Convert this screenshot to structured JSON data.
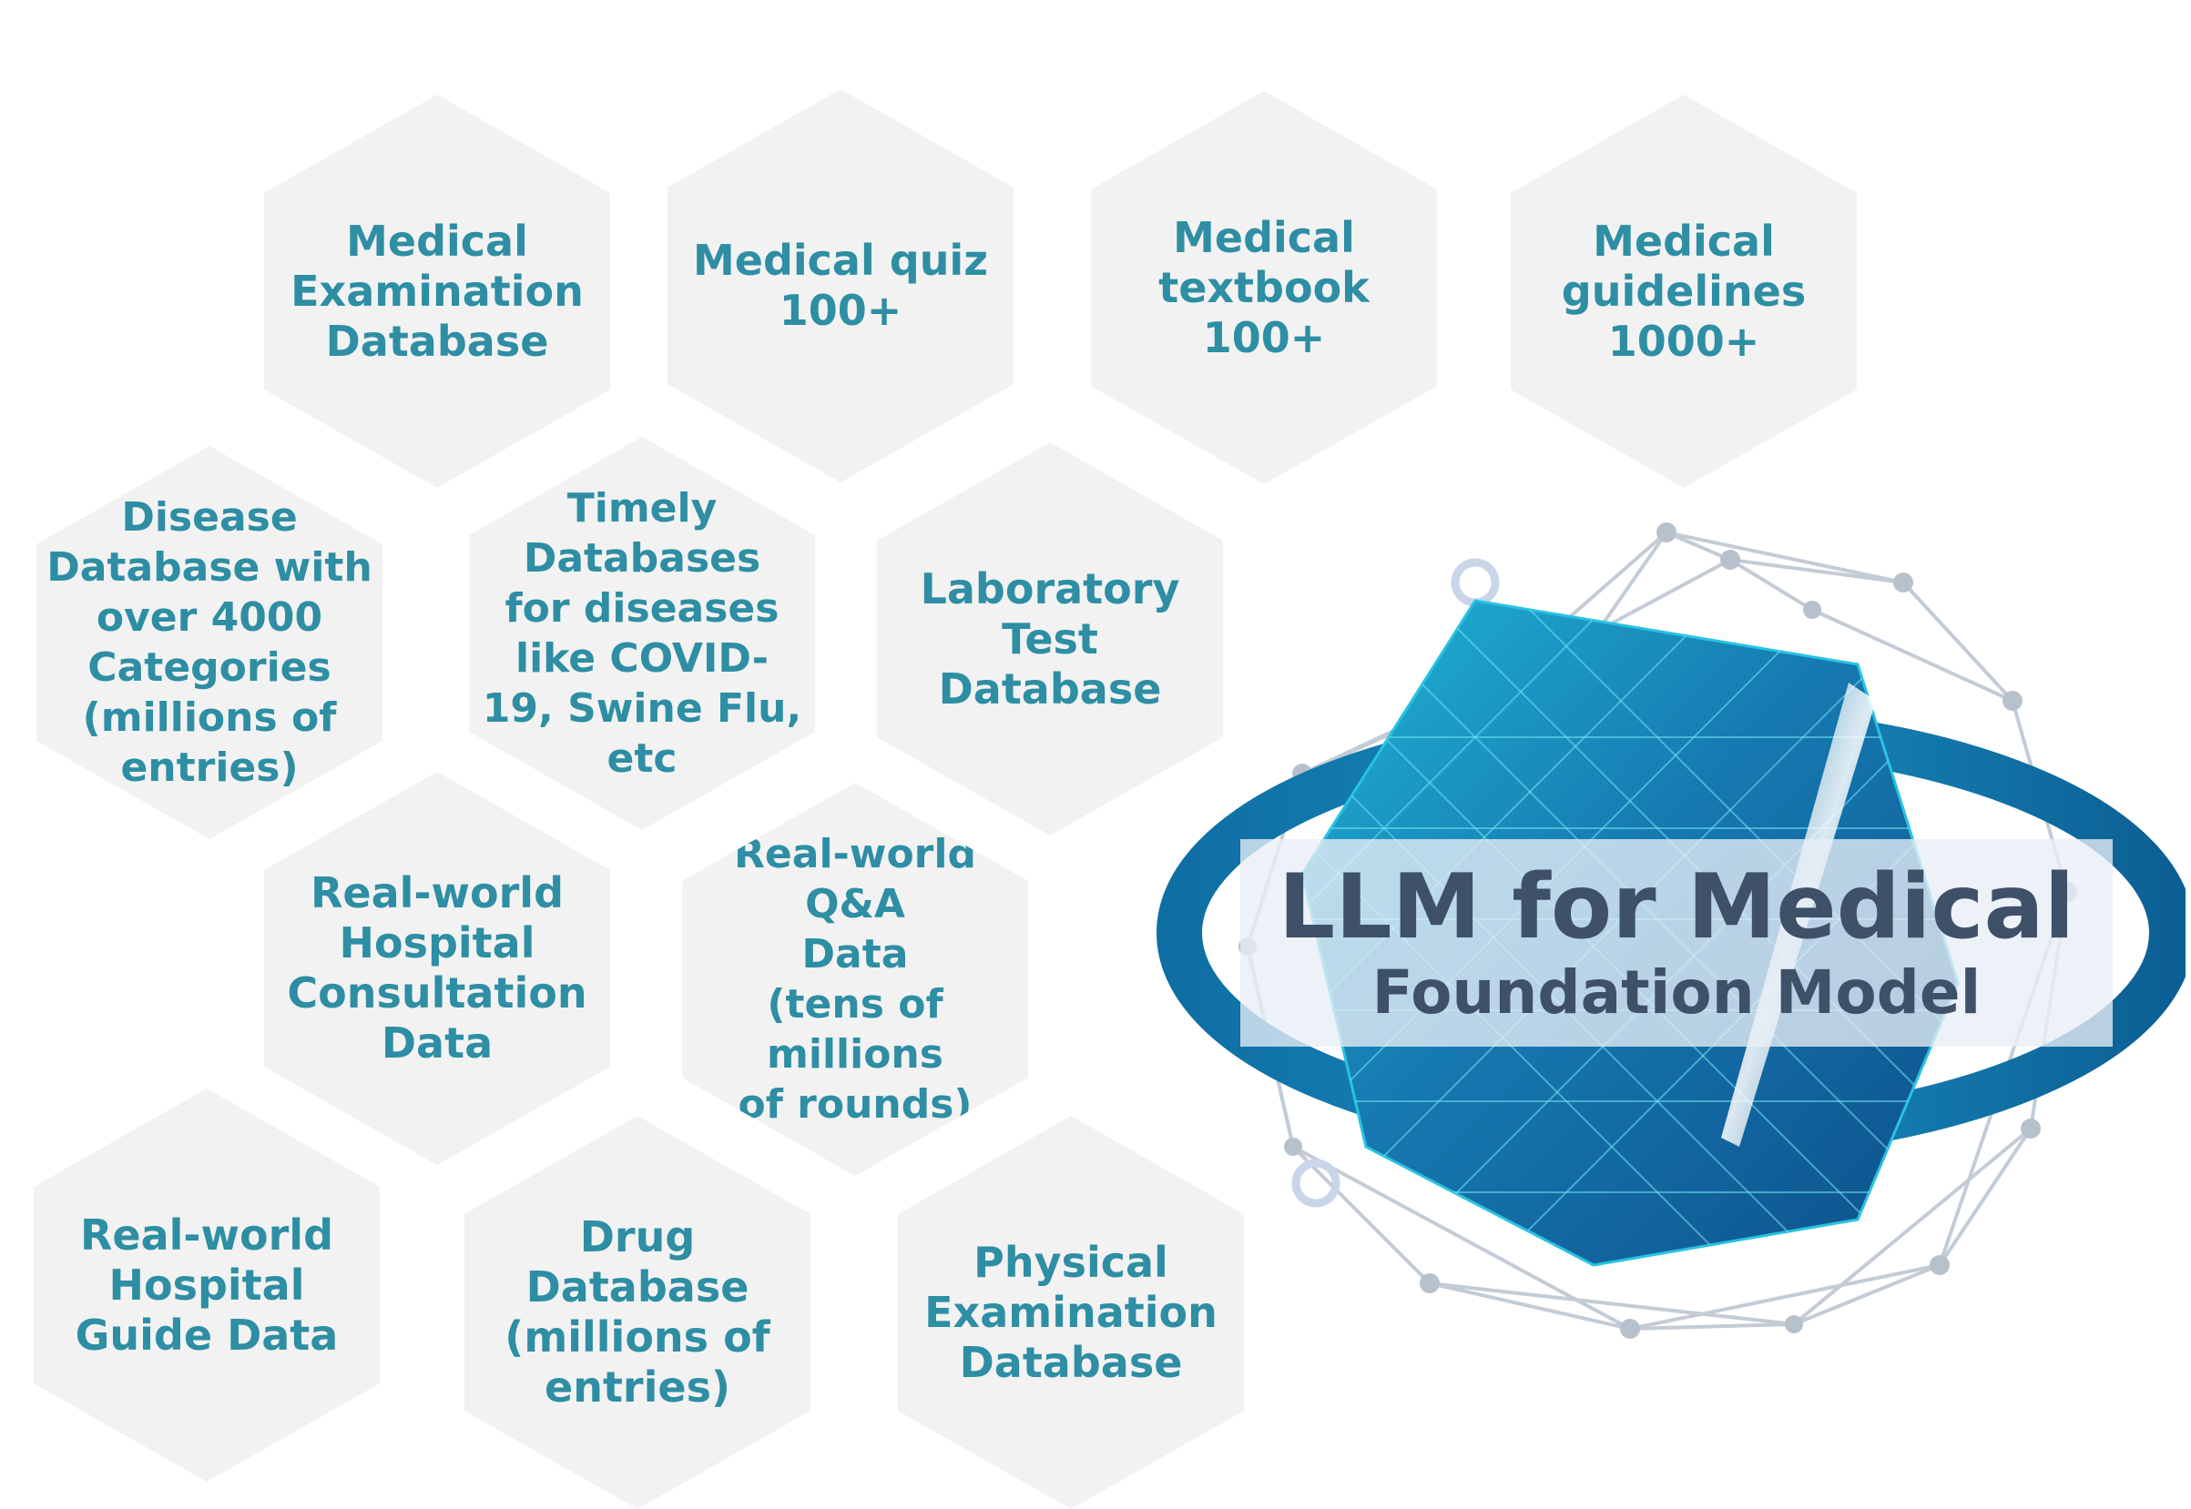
{
  "hexagons": [
    {
      "label": "Medical\nExamination\nDatabase"
    },
    {
      "label": "Medical quiz\n100+"
    },
    {
      "label": "Medical\ntextbook\n100+"
    },
    {
      "label": "Medical\nguidelines\n1000+"
    },
    {
      "label": "Disease\nDatabase with\nover 4000\nCategories\n(millions of\nentries)"
    },
    {
      "label": "Timely\nDatabases\nfor diseases\nlike COVID-\n19, Swine Flu,\netc"
    },
    {
      "label": "Laboratory\nTest\nDatabase"
    },
    {
      "label": "Real-world\nHospital\nConsultation\nData"
    },
    {
      "label": "Real-world Q&A\nData\n(tens of millions\nof rounds)"
    },
    {
      "label": "Real-world\nHospital\nGuide Data"
    },
    {
      "label": "Drug Database\n(millions of\nentries)"
    },
    {
      "label": "Physical\nExamination\nDatabase"
    }
  ],
  "model": {
    "title": "LLM for Medical",
    "subtitle": "Foundation Model"
  },
  "colors": {
    "hex_fill": "#f2f2f2",
    "hex_text": "#2e8ea3",
    "banner_text": "#3f5069"
  }
}
